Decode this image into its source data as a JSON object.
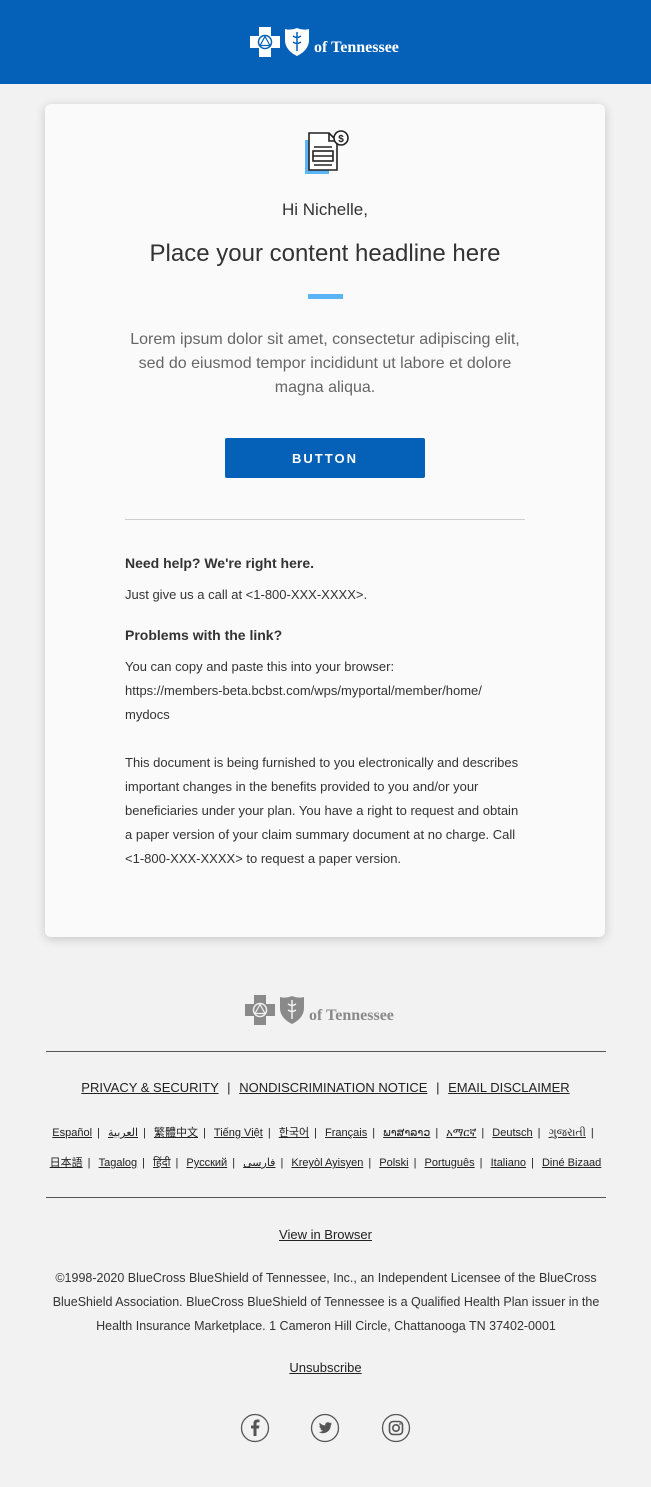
{
  "header": {
    "logo_text": "of Tennessee",
    "background_color": "#0561b8"
  },
  "card": {
    "icon": "document-dollar-icon",
    "greeting": "Hi Nichelle,",
    "headline": "Place your content headline here",
    "body": "Lorem ipsum dolor sit amet, consectetur adipiscing elit, sed do eiusmod tempor incididunt ut labore et dolore magna aliqua.",
    "button_label": "BUTTON",
    "help_title": "Need help? We're right here.",
    "help_text": "Just give us a call at <1-800-XXX-XXXX>.",
    "link_title": "Problems with the link?",
    "link_intro": "You can copy and paste this into your browser:",
    "link_url_1": "https://members-beta.bcbst.com/wps/myportal/member/home/",
    "link_url_2": "mydocs",
    "disclaimer": "This document is being furnished to you electronically and describes important changes in the benefits provided to you and/or your beneficiaries under your plan. You have a right to request and obtain a paper version of your claim summary document at no charge. Call <1-800-XXX-XXXX> to request a paper version."
  },
  "footer": {
    "logo_text": "of Tennessee",
    "links": [
      "PRIVACY & SECURITY",
      "NONDISCRIMINATION NOTICE",
      "EMAIL DISCLAIMER"
    ],
    "languages_row1": [
      "Español",
      "العربية",
      "繁體中文",
      "Tiếng Việt",
      "한국어",
      "Français",
      "ພາສາລາວ",
      "አማርኛ",
      "Deutsch",
      "ગુજરાતી"
    ],
    "languages_row2": [
      "日本語",
      "Tagalog",
      "हिंदी",
      "Русский",
      "فارسی",
      "Kreyòl Ayisyen",
      "Polski",
      "Português",
      "Italiano",
      "Diné Bizaad"
    ],
    "view_in_browser": "View in Browser",
    "copyright": "©1998-2020 BlueCross BlueShield of Tennessee, Inc., an Independent Licensee of the BlueCross BlueShield Association. BlueCross BlueShield of Tennessee is a Qualified Health Plan issuer in the Health Insurance Marketplace. 1 Cameron Hill Circle, Chattanooga TN 37402-0001",
    "unsubscribe": "Unsubscribe",
    "social_icons": [
      "facebook-icon",
      "twitter-icon",
      "instagram-icon"
    ]
  }
}
